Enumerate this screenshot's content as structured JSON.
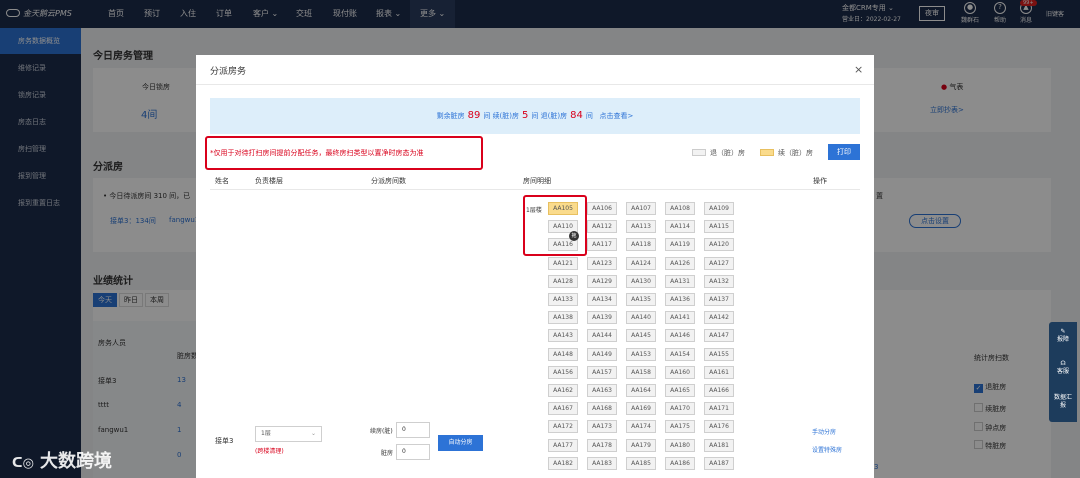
{
  "app": {
    "logo": "金天鹅云PMS",
    "nav": [
      "首页",
      "预订",
      "入住",
      "订单",
      "客户",
      "交班",
      "现付账",
      "报表",
      "更多"
    ],
    "hotel_name": "金都CRM专用",
    "business_date": "营业日：2022-02-27",
    "night_audit": "夜审",
    "icons": [
      {
        "name": "user-icon",
        "label": "魏群石"
      },
      {
        "name": "help-icon",
        "label": "帮助"
      },
      {
        "name": "bell-icon",
        "label": "消息"
      }
    ],
    "message_count": "99+",
    "username": "旧键客"
  },
  "sidebar": {
    "items": [
      "房务数据概览",
      "维修记录",
      "锁房记录",
      "房态日志",
      "房扫管理",
      "报到管理",
      "报到重置日志"
    ]
  },
  "background": {
    "today_title": "今日房务管理",
    "today_lock_label": "今日锁房",
    "today_lock_value": "4间",
    "weather": "气表",
    "stats_link": "立即抄表>",
    "dispatch_title": "分派房",
    "dispatch_info": "今日待派房间 310 间，已",
    "dispatch_row": "接单3：134间",
    "dispatch_user": "fangwu1",
    "settings_text": "置",
    "settings_button": "点击设置",
    "perf_title": "业绩统计",
    "perf_tabs": [
      "今天",
      "昨日",
      "本周"
    ],
    "perf_table_headers": [
      "房务人员",
      "脏房数"
    ],
    "perf_rows": [
      {
        "name": "接单3",
        "value": "13"
      },
      {
        "name": "tttt",
        "value": "4"
      },
      {
        "name": "fangwu1",
        "value": "1"
      },
      {
        "name": "",
        "value": "0"
      }
    ],
    "room_stats_title": "统计房扫数",
    "room_stats_options": [
      {
        "label": "退脏房",
        "checked": true
      },
      {
        "label": "续脏房",
        "checked": false
      },
      {
        "label": "钟点房",
        "checked": false
      },
      {
        "label": "特脏房",
        "checked": false
      }
    ],
    "side_number": "3"
  },
  "modal": {
    "title": "分派房务",
    "close": "×",
    "summary": {
      "remaining_label": "剩余脏房",
      "remaining": "89",
      "unit1": "间",
      "stay_label": "续(脏)房",
      "stay": "5",
      "unit2": "间",
      "checkout_label": "退(脏)房",
      "checkout": "84",
      "unit3": "间",
      "view_link": "点击查看>"
    },
    "warning": "*仅用于对待打扫房间提前分配任务，最终房扫类型以置净时房态为准",
    "legend": [
      {
        "label": "退（脏）房",
        "color": "#f2f2f2"
      },
      {
        "label": "续（脏）房",
        "color": "#fadb8c"
      }
    ],
    "print_button": "打印",
    "columns": [
      "姓名",
      "负责楼层",
      "分派房间数",
      "房间明细",
      "操作"
    ],
    "row": {
      "name": "接单3",
      "floor_select": "1层",
      "cross_floor": "(跨楼清理)",
      "stay_label": "续房(脏)",
      "stay_value": "0",
      "dirty_label": "脏房",
      "dirty_value": "0",
      "auto_button": "自动分房",
      "manual_link": "手动分房",
      "special_link": "设置特殊房"
    },
    "floor_label": "1层楼",
    "drag_marker": "拖",
    "rooms": [
      [
        "AA105",
        "AA106",
        "AA107",
        "AA108",
        "AA109"
      ],
      [
        "AA110",
        "AA112",
        "AA113",
        "AA114",
        "AA115"
      ],
      [
        "AA116",
        "AA117",
        "AA118",
        "AA119",
        "AA120"
      ],
      [
        "AA121",
        "AA123",
        "AA124",
        "AA126",
        "AA127"
      ],
      [
        "AA128",
        "AA129",
        "AA130",
        "AA131",
        "AA132"
      ],
      [
        "AA133",
        "AA134",
        "AA135",
        "AA136",
        "AA137"
      ],
      [
        "AA138",
        "AA139",
        "AA140",
        "AA141",
        "AA142"
      ],
      [
        "AA143",
        "AA144",
        "AA145",
        "AA146",
        "AA147"
      ],
      [
        "AA148",
        "AA149",
        "AA153",
        "AA154",
        "AA155"
      ],
      [
        "AA156",
        "AA157",
        "AA158",
        "AA160",
        "AA161"
      ],
      [
        "AA162",
        "AA163",
        "AA164",
        "AA165",
        "AA166"
      ],
      [
        "AA167",
        "AA168",
        "AA169",
        "AA170",
        "AA171"
      ],
      [
        "AA172",
        "AA173",
        "AA174",
        "AA175",
        "AA176"
      ],
      [
        "AA177",
        "AA178",
        "AA179",
        "AA180",
        "AA181"
      ],
      [
        "AA182",
        "AA183",
        "AA185",
        "AA186",
        "AA187"
      ]
    ],
    "dirty_rooms": [
      "AA105"
    ]
  },
  "tools": [
    "报障",
    "客服",
    "数据汇报"
  ],
  "watermark": "大数跨境"
}
